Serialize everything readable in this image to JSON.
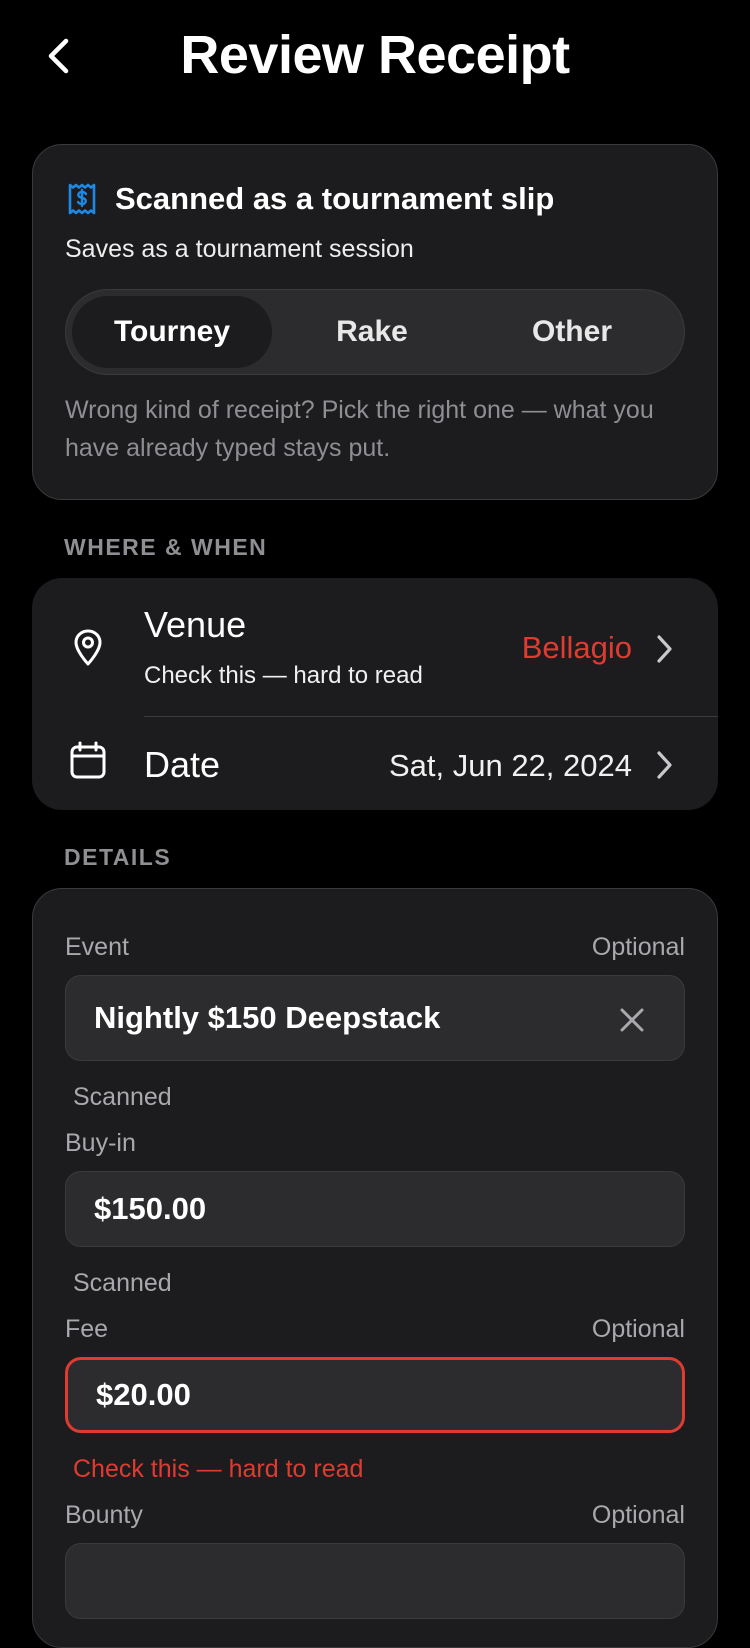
{
  "nav": {
    "title": "Review Receipt",
    "back_icon": "chevron-left-icon"
  },
  "scan_card": {
    "icon": "receipt-dollar-icon",
    "icon_color": "#1e88e5",
    "title": "Scanned as a tournament slip",
    "subtitle": "Saves as a tournament session",
    "segments": [
      {
        "label": "Tourney",
        "selected": true
      },
      {
        "label": "Rake",
        "selected": false
      },
      {
        "label": "Other",
        "selected": false
      }
    ],
    "note": "Wrong kind of receipt? Pick the right one — what you have already typed stays put."
  },
  "where_when": {
    "section_label": "WHERE & WHEN",
    "venue": {
      "label": "Venue",
      "warning": "Check this — hard to read",
      "value": "Bellagio",
      "value_color": "#e03b31",
      "icon": "location-pin-icon"
    },
    "date": {
      "label": "Date",
      "value": "Sat, Jun 22, 2024",
      "icon": "calendar-icon"
    }
  },
  "details": {
    "section_label": "DETAILS",
    "fields": {
      "event": {
        "label": "Event",
        "optional": "Optional",
        "value": "Nightly $150 Deepstack",
        "hint": "Scanned"
      },
      "buyin": {
        "label": "Buy-in",
        "value": "$150.00",
        "hint": "Scanned"
      },
      "fee": {
        "label": "Fee",
        "optional": "Optional",
        "value": "$20.00",
        "hint": "Check this — hard to read",
        "error_color": "#e03b31"
      },
      "bounty": {
        "label": "Bounty",
        "optional": "Optional",
        "value": ""
      }
    }
  }
}
